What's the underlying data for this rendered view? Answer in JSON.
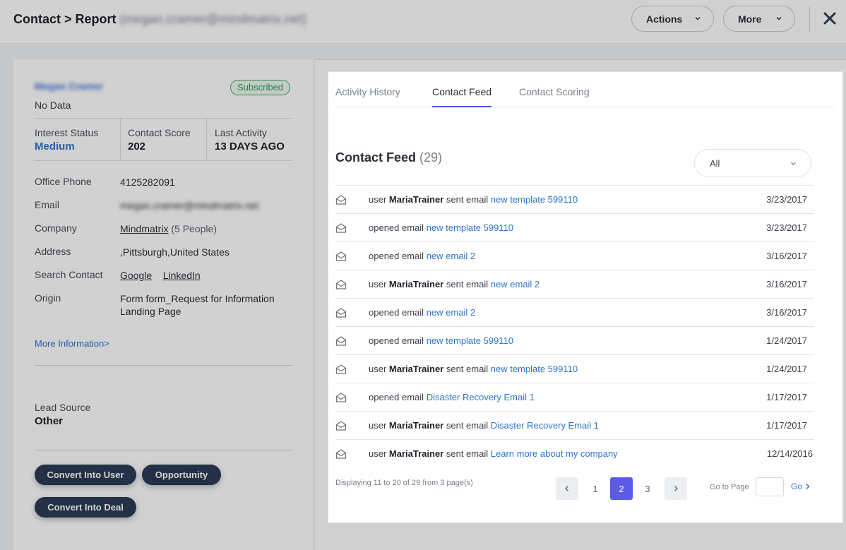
{
  "header": {
    "title_prefix": "Contact > Report",
    "title_blurred": "(megan.cramer@mindmatrix.net)",
    "title_suffix": ")",
    "actions_label": "Actions",
    "more_label": "More"
  },
  "contact": {
    "name": "Megan Cramer",
    "badge": "Subscribed",
    "subtitle": "No Data",
    "stats": [
      {
        "label": "Interest Status",
        "value": "Medium"
      },
      {
        "label": "Contact Score",
        "value": "202"
      },
      {
        "label": "Last Activity",
        "value": "13 DAYS AGO"
      }
    ],
    "office_phone_label": "Office Phone",
    "office_phone": "4125282091",
    "email_label": "Email",
    "email": "megan.cramer@mindmatrix.net",
    "company_label": "Company",
    "company": "Mindmatrix",
    "company_people": "(5 People)",
    "address_label": "Address",
    "address": ",Pittsburgh,United States",
    "search_label": "Search Contact",
    "search_google": "Google",
    "search_linkedin": "LinkedIn",
    "origin_label": "Origin",
    "origin": "Form form_Request for Information Landing Page",
    "more_info": "More Information>",
    "lead_source_label": "Lead Source",
    "lead_source": "Other",
    "buttons": {
      "convert_user": "Convert Into User",
      "opportunity": "Opportunity",
      "convert_deal": "Convert Into Deal"
    }
  },
  "tabs": [
    {
      "label": "Activity History",
      "active": false
    },
    {
      "label": "Contact Feed",
      "active": true
    },
    {
      "label": "Contact Scoring",
      "active": false
    }
  ],
  "feed": {
    "heading": "Contact Feed",
    "count": "(29)",
    "filter_value": "All",
    "rows": [
      {
        "user": "MariaTrainer",
        "action": "sent email",
        "link": "new template 599110",
        "date": "3/23/2017"
      },
      {
        "user": "",
        "action": "opened email",
        "link": "new template 599110",
        "date": "3/23/2017"
      },
      {
        "user": "",
        "action": "opened email",
        "link": "new email 2",
        "date": "3/16/2017"
      },
      {
        "user": "MariaTrainer",
        "action": "sent email",
        "link": "new email 2",
        "date": "3/16/2017"
      },
      {
        "user": "",
        "action": "opened email",
        "link": "new email 2",
        "date": "3/16/2017"
      },
      {
        "user": "",
        "action": "opened email",
        "link": "new template 599110",
        "date": "1/24/2017"
      },
      {
        "user": "MariaTrainer",
        "action": "sent email",
        "link": "new template 599110",
        "date": "1/24/2017"
      },
      {
        "user": "",
        "action": "opened email",
        "link": "Disaster Recovery Email 1",
        "date": "1/17/2017"
      },
      {
        "user": "MariaTrainer",
        "action": "sent email",
        "link": "Disaster Recovery Email 1",
        "date": "1/17/2017"
      },
      {
        "user": "MariaTrainer",
        "action": "sent email",
        "link": "Learn more about my company",
        "date": "12/14/2016"
      }
    ],
    "user_prefix": "user",
    "pagination": {
      "info": "Displaying 11 to 20 of 29 from 3 page(s)",
      "pages": [
        "1",
        "2",
        "3"
      ],
      "current": "2",
      "goto_label": "Go to Page",
      "goto_value": "",
      "go_label": "Go"
    }
  },
  "colors": {
    "accent": "#5b5be8",
    "link": "#2e75c9",
    "badge_green": "#2f9a56",
    "dark_button": "#2c3b55"
  },
  "icons": {
    "close": "close-icon",
    "row": "envelope-open-icon",
    "dropdown": "chevron-down-icon"
  }
}
